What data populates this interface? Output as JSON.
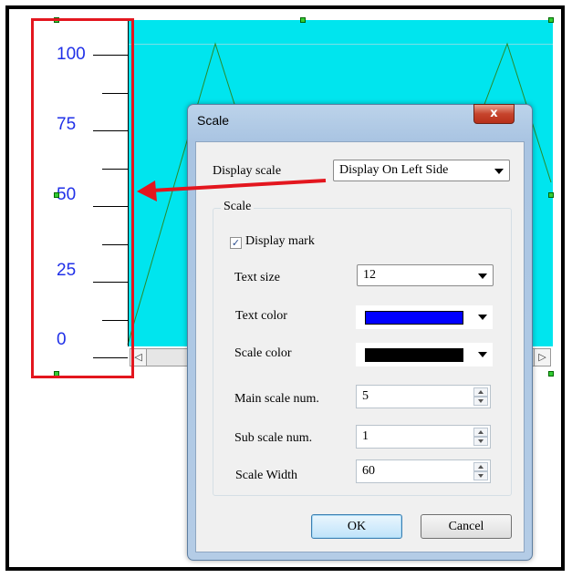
{
  "scale_panel": {
    "labels": [
      "100",
      "75",
      "50",
      "25",
      "0"
    ]
  },
  "scrollbar": {
    "left_arrow": "◁",
    "right_arrow": "▷"
  },
  "dialog": {
    "title": "Scale",
    "close_label": "x",
    "display_scale_label": "Display scale",
    "display_scale_value": "Display On Left Side",
    "group_title": "Scale",
    "display_mark_label": "Display mark",
    "display_mark_checked": true,
    "text_size_label": "Text size",
    "text_size_value": "12",
    "text_color_label": "Text color",
    "text_color_value": "#0000ff",
    "scale_color_label": "Scale color",
    "scale_color_value": "#000000",
    "main_scale_label": "Main scale num.",
    "main_scale_value": "5",
    "sub_scale_label": "Sub scale num.",
    "sub_scale_value": "1",
    "scale_width_label": "Scale Width",
    "scale_width_value": "60",
    "ok_label": "OK",
    "cancel_label": "Cancel"
  },
  "colors": {
    "chart_background": "#00e5ee",
    "highlight_box": "#e3161e",
    "arrow": "#e3161e",
    "scale_text": "#2030e8"
  }
}
